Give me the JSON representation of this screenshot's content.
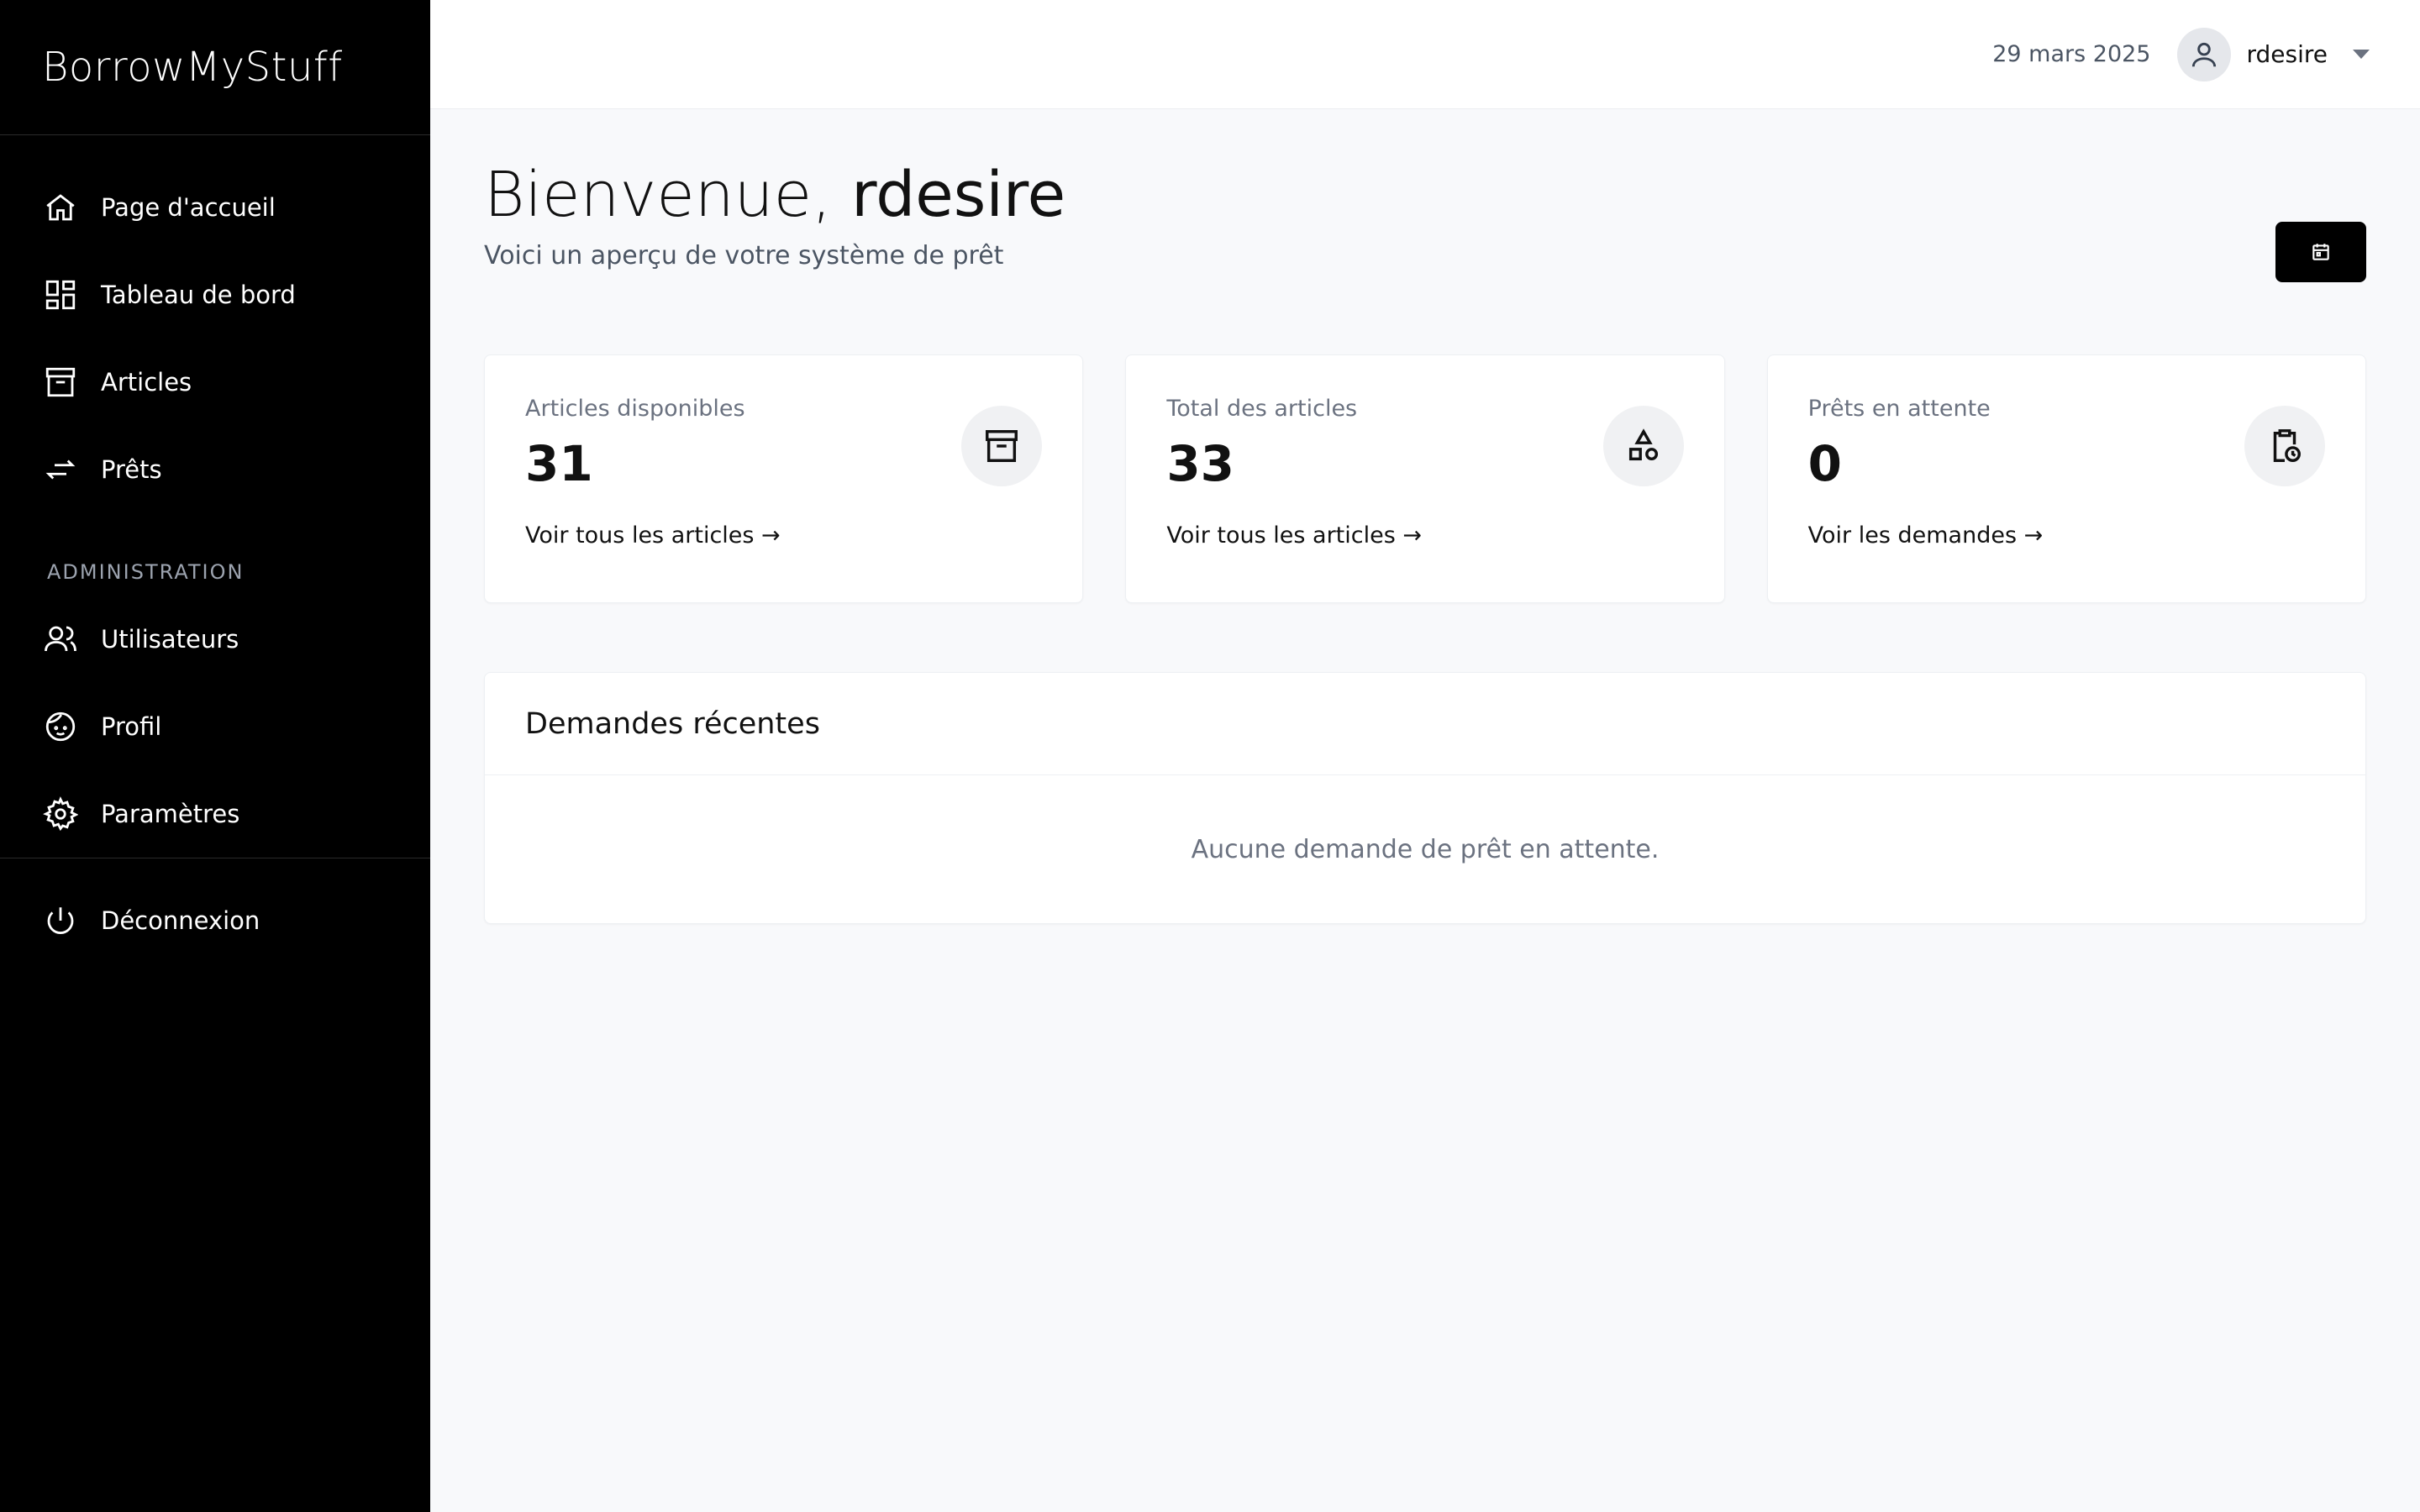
{
  "brand": "BorrowMyStuff",
  "sidebar": {
    "items": [
      {
        "label": "Page d'accueil"
      },
      {
        "label": "Tableau de bord"
      },
      {
        "label": "Articles"
      },
      {
        "label": "Prêts"
      }
    ],
    "admin_section": "ADMINISTRATION",
    "admin_items": [
      {
        "label": "Utilisateurs"
      },
      {
        "label": "Profil"
      },
      {
        "label": "Paramètres"
      }
    ],
    "logout": "Déconnexion"
  },
  "topbar": {
    "date": "29 mars 2025",
    "username": "rdesire"
  },
  "welcome": {
    "greeting": "Bienvenue, ",
    "name": "rdesire",
    "subtitle": "Voici un aperçu de votre système de prêt"
  },
  "stats": [
    {
      "label": "Articles disponibles",
      "value": "31",
      "link": "Voir tous les articles →"
    },
    {
      "label": "Total des articles",
      "value": "33",
      "link": "Voir tous les articles →"
    },
    {
      "label": "Prêts en attente",
      "value": "0",
      "link": "Voir les demandes →"
    }
  ],
  "recent": {
    "title": "Demandes récentes",
    "empty": "Aucune demande de prêt en attente."
  }
}
